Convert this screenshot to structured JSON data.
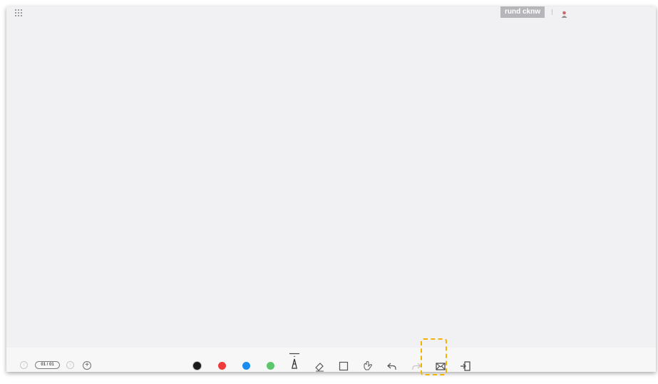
{
  "header": {
    "username": "rund cknw",
    "icons": [
      "apps-grid-icon",
      "user-icon"
    ]
  },
  "pagination": {
    "page_indicator": "01 / 01",
    "icons": [
      "chevron-left-icon",
      "chevron-right-icon",
      "add-page-icon"
    ]
  },
  "toolbar": {
    "colors": [
      "#1a1a1a",
      "#ef3b3b",
      "#1a8cf0",
      "#5cc66b"
    ],
    "tools": [
      "pen-icon",
      "eraser-icon",
      "square-icon",
      "gesture-icon",
      "undo-icon",
      "redo-icon",
      "email-icon",
      "exit-icon"
    ],
    "highlight_color": "#f2b300"
  }
}
